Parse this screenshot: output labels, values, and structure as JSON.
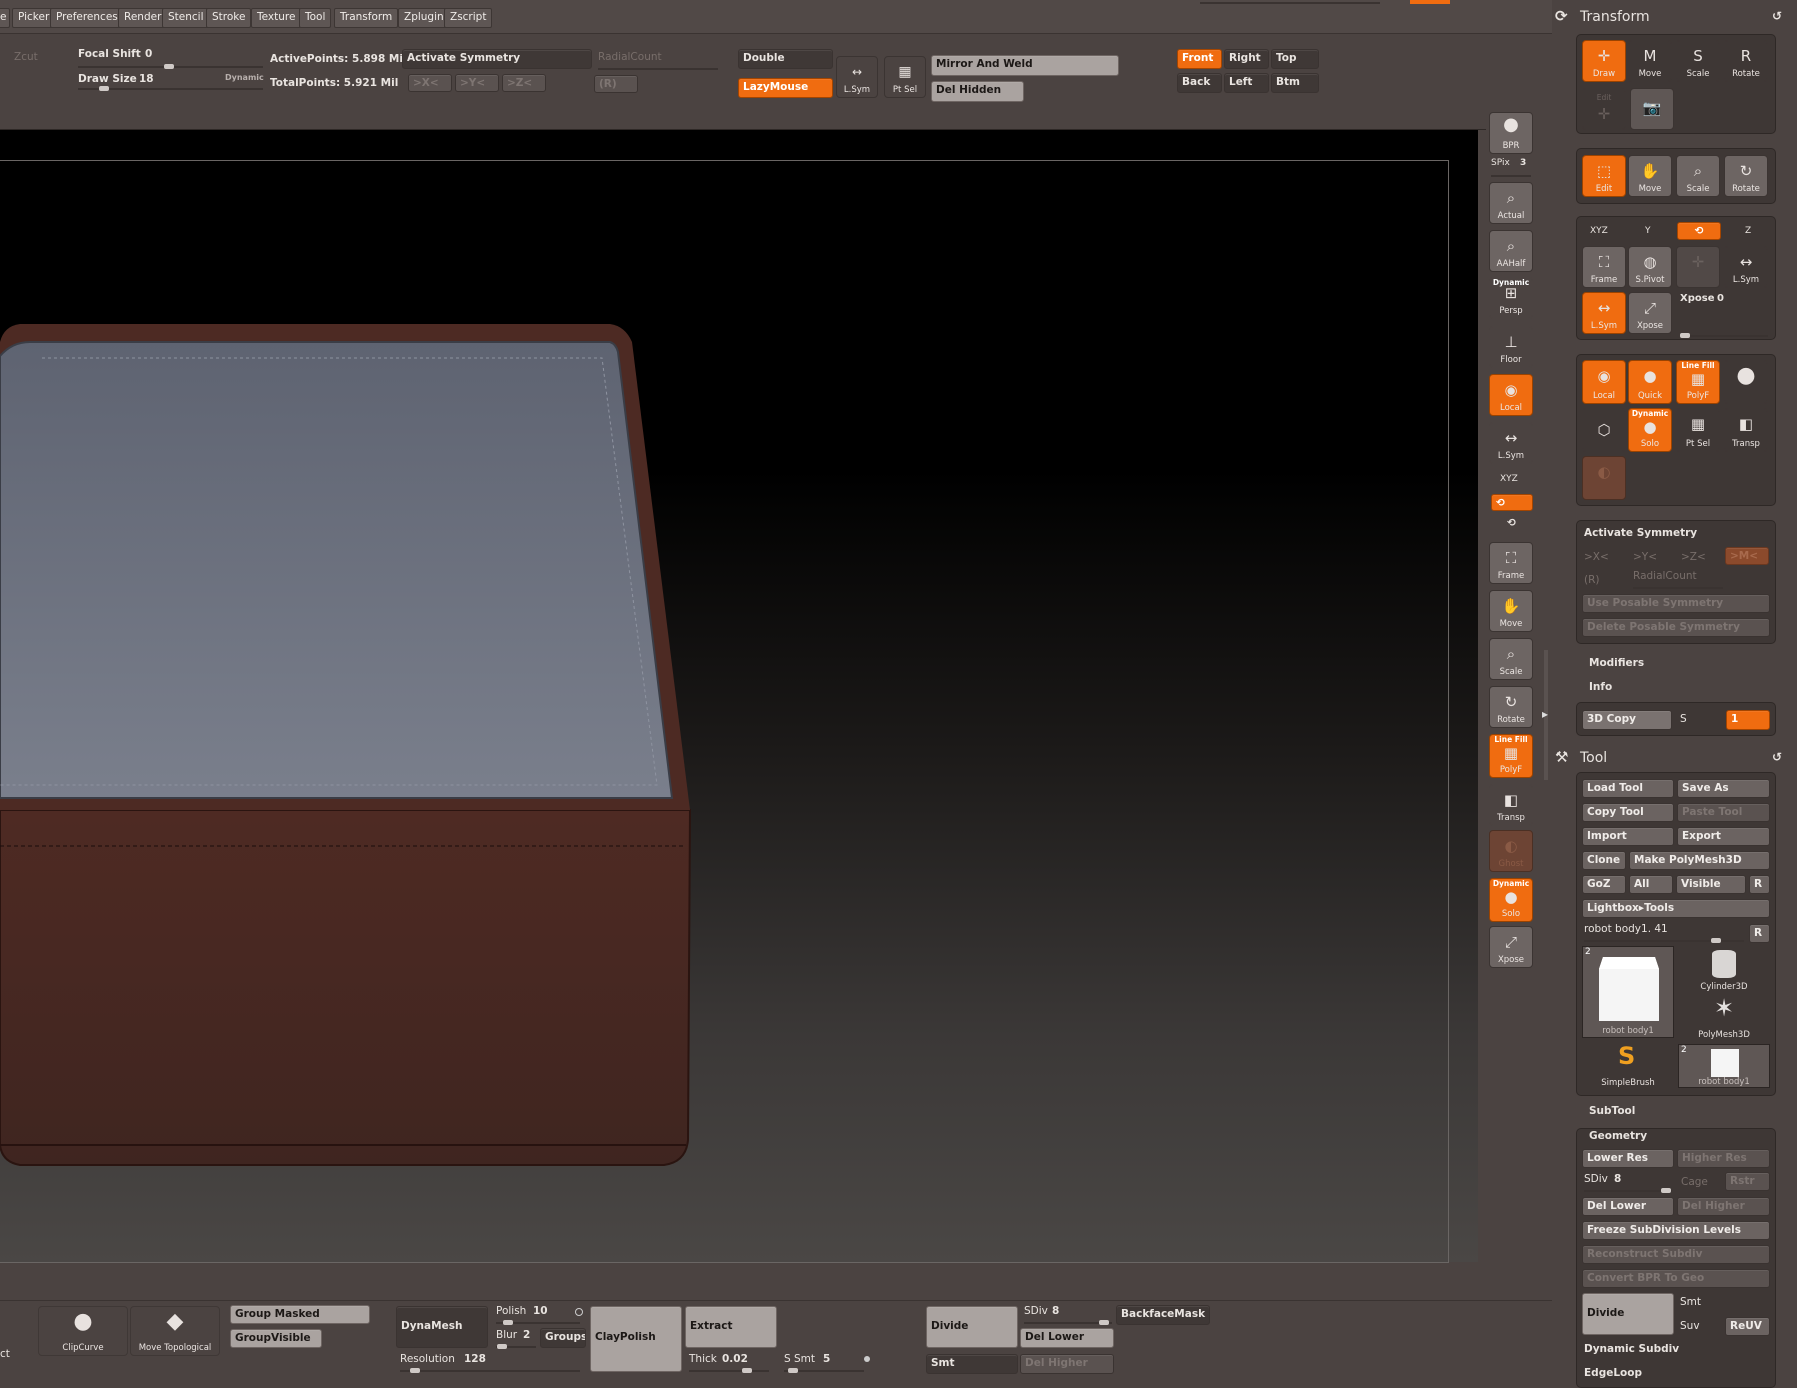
{
  "menu": [
    "e",
    "Picker",
    "Preferences",
    "Render",
    "Stencil",
    "Stroke",
    "Texture",
    "Tool",
    "Transform",
    "Zplugin",
    "Zscript"
  ],
  "topbar": {
    "zcut": "Zcut",
    "focal_shift_label": "Focal Shift",
    "focal_shift_value": "0",
    "draw_size_label": "Draw Size",
    "draw_size_value": "18",
    "dynamic": "Dynamic",
    "active_points": "ActivePoints: 5.898 Mil",
    "total_points": "TotalPoints: 5.921 Mil",
    "activate_symmetry": "Activate Symmetry",
    "radial_count": "RadialCount",
    "sym_x": ">X<",
    "sym_y": ">Y<",
    "sym_z": ">Z<",
    "r": "(R)",
    "double": "Double",
    "lazymouse": "LazyMouse",
    "lsym": "L.Sym",
    "ptsel": "Pt Sel",
    "mirror_weld": "Mirror And Weld",
    "del_hidden": "Del Hidden",
    "views": [
      "Front",
      "Right",
      "Top",
      "Back",
      "Left",
      "Btm"
    ]
  },
  "right_shelf": {
    "bpr": "BPR",
    "spix_label": "SPix",
    "spix_value": "3",
    "items": [
      "Actual",
      "AAHalf",
      "Persp",
      "Floor",
      "Local",
      "L.Sym",
      "Frame",
      "Move",
      "Scale",
      "Rotate",
      "PolyF",
      "Transp",
      "Ghost",
      "Solo",
      "Xpose"
    ],
    "persp_top": "Dynamic",
    "polyf_top": "Line Fill",
    "solo_top": "Dynamic",
    "xyz": "XYZ"
  },
  "transform": {
    "title": "Transform",
    "row1": [
      "Draw",
      "Move",
      "Scale",
      "Rotate"
    ],
    "edit_label": "Edit",
    "row2": [
      "Edit",
      "Move",
      "Scale",
      "Rotate"
    ],
    "axes": [
      "XYZ",
      "Y",
      "",
      "Z"
    ],
    "row3": [
      "Frame",
      "S.Pivot",
      "",
      "L.Sym"
    ],
    "lsym": "L.Sym",
    "xpose_btn": "Xpose",
    "xpose_label": "Xpose",
    "xpose_value": "0",
    "row4": [
      "Local",
      "Quick",
      "PolyF",
      ""
    ],
    "row4_top": "Line Fill",
    "row5": [
      "",
      "Solo",
      "Pt Sel",
      "Transp"
    ],
    "solo_top": "Dynamic",
    "activate_symmetry": "Activate Symmetry",
    "sym_x": ">X<",
    "sym_y": ">Y<",
    "sym_z": ">Z<",
    "sym_m": ">M<",
    "r": "(R)",
    "radial_count": "RadialCount",
    "use_posable": "Use Posable Symmetry",
    "delete_posable": "Delete Posable Symmetry",
    "modifiers": "Modifiers",
    "info": "Info",
    "copy3d": "3D Copy",
    "s_label": "S",
    "s_value": "1"
  },
  "tool": {
    "title": "Tool",
    "load": "Load Tool",
    "save_as": "Save As",
    "copy": "Copy Tool",
    "paste": "Paste Tool",
    "import": "Import",
    "export": "Export",
    "clone": "Clone",
    "make_polymesh": "Make PolyMesh3D",
    "goz": "GoZ",
    "all": "All",
    "visible": "Visible",
    "r": "R",
    "lightbox": "Lightbox▸Tools",
    "current": "robot body1. 41",
    "thumbs": [
      "robot body1",
      "Cylinder3D",
      "PolyMesh3D",
      "SimpleBrush",
      "robot body1"
    ],
    "thumb_badge": "2",
    "subtool": "SubTool",
    "geometry": "Geometry",
    "lower_res": "Lower Res",
    "higher_res": "Higher Res",
    "sdiv_label": "SDiv",
    "sdiv_value": "8",
    "cage": "Cage",
    "rstr": "Rstr",
    "del_lower": "Del Lower",
    "del_higher": "Del Higher",
    "freeze": "Freeze SubDivision Levels",
    "reconstruct": "Reconstruct Subdiv",
    "convert_bpr": "Convert BPR To Geo",
    "divide": "Divide",
    "smt": "Smt",
    "suv": "Suv",
    "reuv": "ReUV",
    "dynamic_subdiv": "Dynamic Subdiv",
    "edgeloop": "EdgeLoop"
  },
  "bottombar": {
    "edge": "ct",
    "clipcurve": "ClipCurve",
    "move_topological": "Move Topological",
    "group_masked": "Group Masked",
    "group_visible": "GroupVisible",
    "dynamesh": "DynaMesh",
    "polish_label": "Polish",
    "polish_value": "10",
    "blur_label": "Blur",
    "blur_value": "2",
    "groups": "Groups",
    "resolution_label": "Resolution",
    "resolution_value": "128",
    "claypolish": "ClayPolish",
    "extract": "Extract",
    "thick_label": "Thick",
    "thick_value": "0.02",
    "s_smt_label": "S Smt",
    "s_smt_value": "5",
    "divide": "Divide",
    "sdiv_label": "SDiv",
    "sdiv_value": "8",
    "del_lower": "Del Lower",
    "smt": "Smt",
    "del_higher": "Del Higher",
    "backface": "BackfaceMask"
  },
  "colors": {
    "accent": "#f06c10",
    "background": "#4b4341",
    "panel": "#3e3735",
    "model_top": "#6c7180",
    "model_side": "#4e2a23"
  }
}
